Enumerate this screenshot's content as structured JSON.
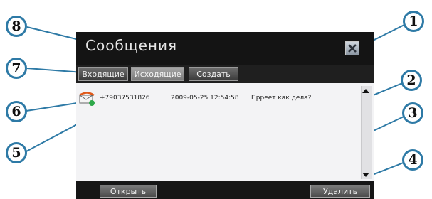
{
  "window": {
    "title": "Сообщения",
    "close_icon": "close-x-icon"
  },
  "tabs": [
    {
      "label": "Входящие",
      "active": false
    },
    {
      "label": "Исходящие",
      "active": true
    },
    {
      "label": "Создать",
      "active": false
    }
  ],
  "messages": [
    {
      "icon": "envelope-outgoing-icon",
      "number": "+79037531826",
      "datetime": "2009-05-25 12:54:58",
      "text": "Прреет как дела?"
    }
  ],
  "buttons": {
    "open": "Открыть",
    "delete": "Удалить"
  },
  "callouts": [
    "1",
    "2",
    "3",
    "4",
    "5",
    "6",
    "7",
    "8"
  ],
  "colors": {
    "callout_border": "#2e7aa6",
    "window_bg": "#141414",
    "list_bg": "#f3f3f5"
  }
}
